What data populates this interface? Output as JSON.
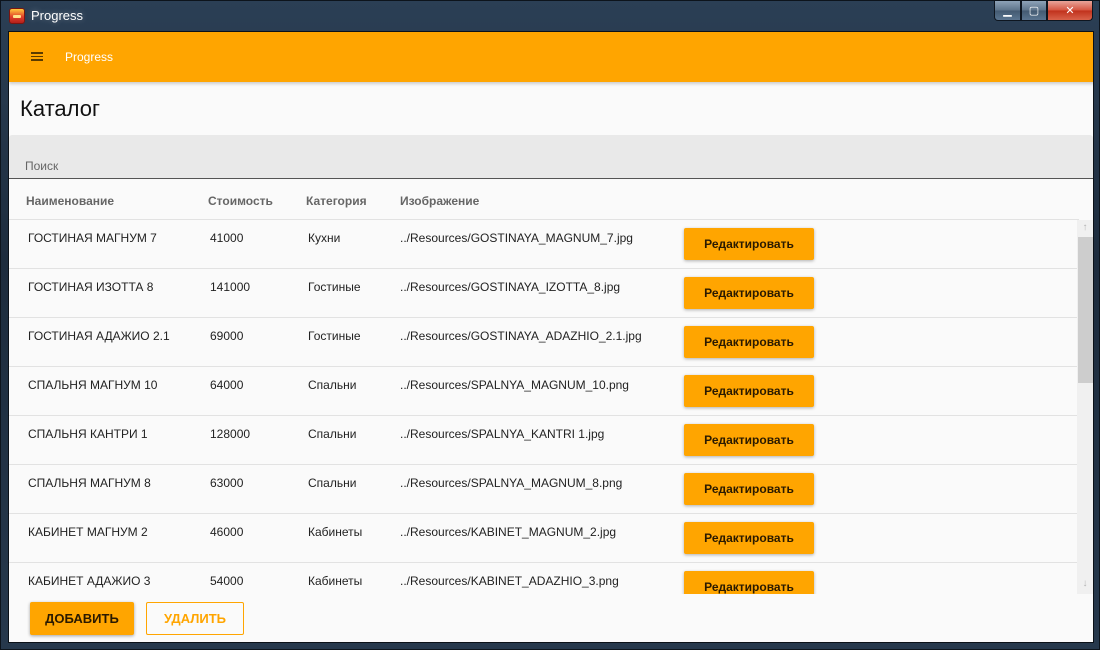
{
  "window": {
    "title": "Progress",
    "controls": {
      "minimize": "▁",
      "maximize": "▢",
      "close": "✕"
    }
  },
  "appbar": {
    "title": "Progress"
  },
  "page": {
    "title": "Каталог"
  },
  "search": {
    "placeholder": "Поиск",
    "value": ""
  },
  "table": {
    "columns": [
      "Наименование",
      "Стоимость",
      "Категория",
      "Изображение"
    ],
    "edit_label": "Редактировать",
    "rows": [
      {
        "name": "ГОСТИНАЯ МАГНУМ 7",
        "price": "41000",
        "category": "Кухни",
        "image": "../Resources/GOSTINAYA_MAGNUM_7.jpg"
      },
      {
        "name": "ГОСТИНАЯ ИЗОТТА 8",
        "price": "141000",
        "category": "Гостиные",
        "image": "../Resources/GOSTINAYA_IZOTTA_8.jpg"
      },
      {
        "name": "ГОСТИНАЯ АДАЖИО 2.1",
        "price": "69000",
        "category": "Гостиные",
        "image": "../Resources/GOSTINAYA_ADAZHIO_2.1.jpg"
      },
      {
        "name": "СПАЛЬНЯ МАГНУМ 10",
        "price": "64000",
        "category": "Спальни",
        "image": "../Resources/SPALNYA_MAGNUM_10.png"
      },
      {
        "name": "СПАЛЬНЯ КАНТРИ 1",
        "price": "128000",
        "category": "Спальни",
        "image": "../Resources/SPALNYA_KANTRI 1.jpg"
      },
      {
        "name": "СПАЛЬНЯ МАГНУМ 8",
        "price": "63000",
        "category": "Спальни",
        "image": "../Resources/SPALNYA_MAGNUM_8.png"
      },
      {
        "name": "КАБИНЕТ МАГНУМ 2",
        "price": "46000",
        "category": "Кабинеты",
        "image": "../Resources/KABINET_MAGNUM_2.jpg"
      },
      {
        "name": "КАБИНЕТ АДАЖИО 3",
        "price": "54000",
        "category": "Кабинеты",
        "image": "../Resources/KABINET_ADAZHIO_3.png"
      }
    ]
  },
  "scrollbar": {
    "up": "↑",
    "down": "↓"
  },
  "actions": {
    "add_label": "ДОБАВИТЬ",
    "delete_label": "УДАЛИТЬ"
  },
  "colors": {
    "accent": "#ffa500",
    "background": "#fafafa",
    "search_bg": "#e9e9e9"
  }
}
